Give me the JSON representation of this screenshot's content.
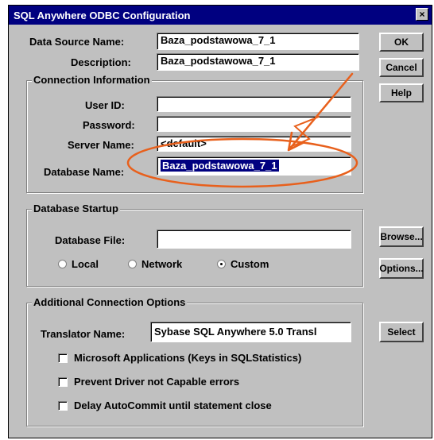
{
  "window": {
    "title": "SQL Anywhere ODBC Configuration",
    "close": "×"
  },
  "fields": {
    "data_source_name": {
      "label": "Data Source Name:",
      "value": "Baza_podstawowa_7_1"
    },
    "description": {
      "label": "Description:",
      "value": "Baza_podstawowa_7_1"
    },
    "user_id": {
      "label": "User ID:",
      "value": ""
    },
    "password": {
      "label": "Password:",
      "value": ""
    },
    "server_name": {
      "label": "Server Name:",
      "value": "<default>"
    },
    "database_name": {
      "label": "Database Name:",
      "value": "Baza_podstawowa_7_1"
    },
    "database_file": {
      "label": "Database File:",
      "value": ""
    },
    "translator_name": {
      "label": "Translator Name:",
      "value": "Sybase SQL Anywhere 5.0 Transl"
    }
  },
  "groups": {
    "connection": "Connection Information",
    "startup": "Database Startup",
    "additional": "Additional Connection Options"
  },
  "buttons": {
    "ok": "OK",
    "cancel": "Cancel",
    "help": "Help",
    "browse": "Browse...",
    "options": "Options...",
    "select": "Select"
  },
  "radios": [
    {
      "label": "Local",
      "checked": false
    },
    {
      "label": "Network",
      "checked": false
    },
    {
      "label": "Custom",
      "checked": true
    }
  ],
  "checkboxes": [
    {
      "label": "Microsoft Applications (Keys in SQLStatistics)",
      "checked": false
    },
    {
      "label": "Prevent Driver not Capable errors",
      "checked": false
    },
    {
      "label": "Delay AutoCommit until statement close",
      "checked": false
    }
  ],
  "annotation_color": "#e8601c"
}
